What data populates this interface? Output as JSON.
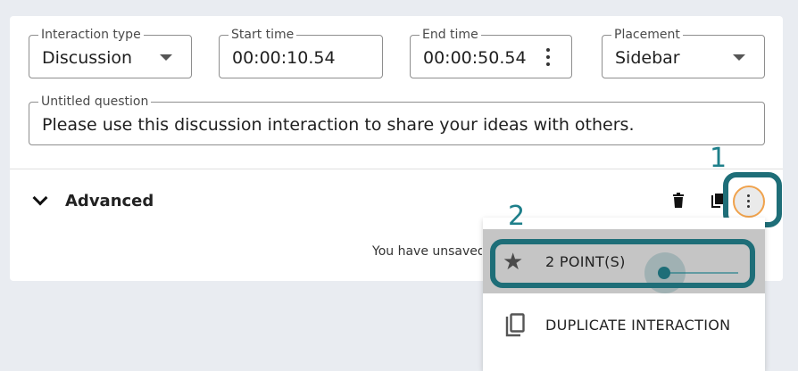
{
  "form": {
    "interaction_type": {
      "label": "Interaction type",
      "value": "Discussion"
    },
    "start_time": {
      "label": "Start time",
      "value": "00:00:10.54"
    },
    "end_time": {
      "label": "End time",
      "value": "00:00:50.54"
    },
    "placement": {
      "label": "Placement",
      "value": "Sidebar"
    },
    "question": {
      "label": "Untitled question",
      "value": "Please use this discussion interaction to share your ideas with others."
    }
  },
  "advanced": {
    "label": "Advanced",
    "icon": "chevron-down-icon"
  },
  "status": {
    "unsaved_text": "You have unsaved changes"
  },
  "annotations": {
    "step1": "1",
    "step2": "2",
    "color": "#1e6e78"
  },
  "menu": {
    "points": {
      "label": "2 POINT(S)",
      "icon": "star-icon",
      "slider_fraction": 0.0
    },
    "duplicate": {
      "label": "DUPLICATE INTERACTION",
      "icon": "copy-icon"
    }
  }
}
